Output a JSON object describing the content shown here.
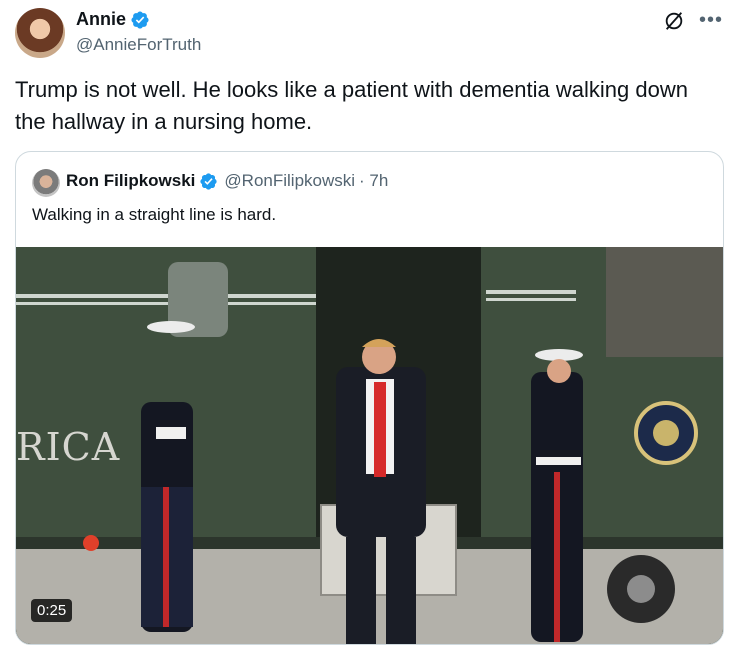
{
  "author": {
    "name": "Annie",
    "handle": "@AnnieForTruth"
  },
  "tweet": {
    "text": "Trump is not well. He looks like a patient with dementia walking down the hallway in a nursing home."
  },
  "quoted": {
    "name": "Ron Filipkowski",
    "handle": "@RonFilipkowski",
    "time": "· 7h",
    "text": "Walking in a straight line is hard.",
    "media": {
      "duration": "0:25",
      "scene_text": "RICA"
    }
  },
  "icons": {
    "verified": "verified-badge-icon",
    "more": "more-options-icon",
    "x": "x-logo-icon"
  },
  "colors": {
    "verified": "#1d9bf0",
    "secondary_text": "#536471",
    "border": "#cfd9de"
  }
}
